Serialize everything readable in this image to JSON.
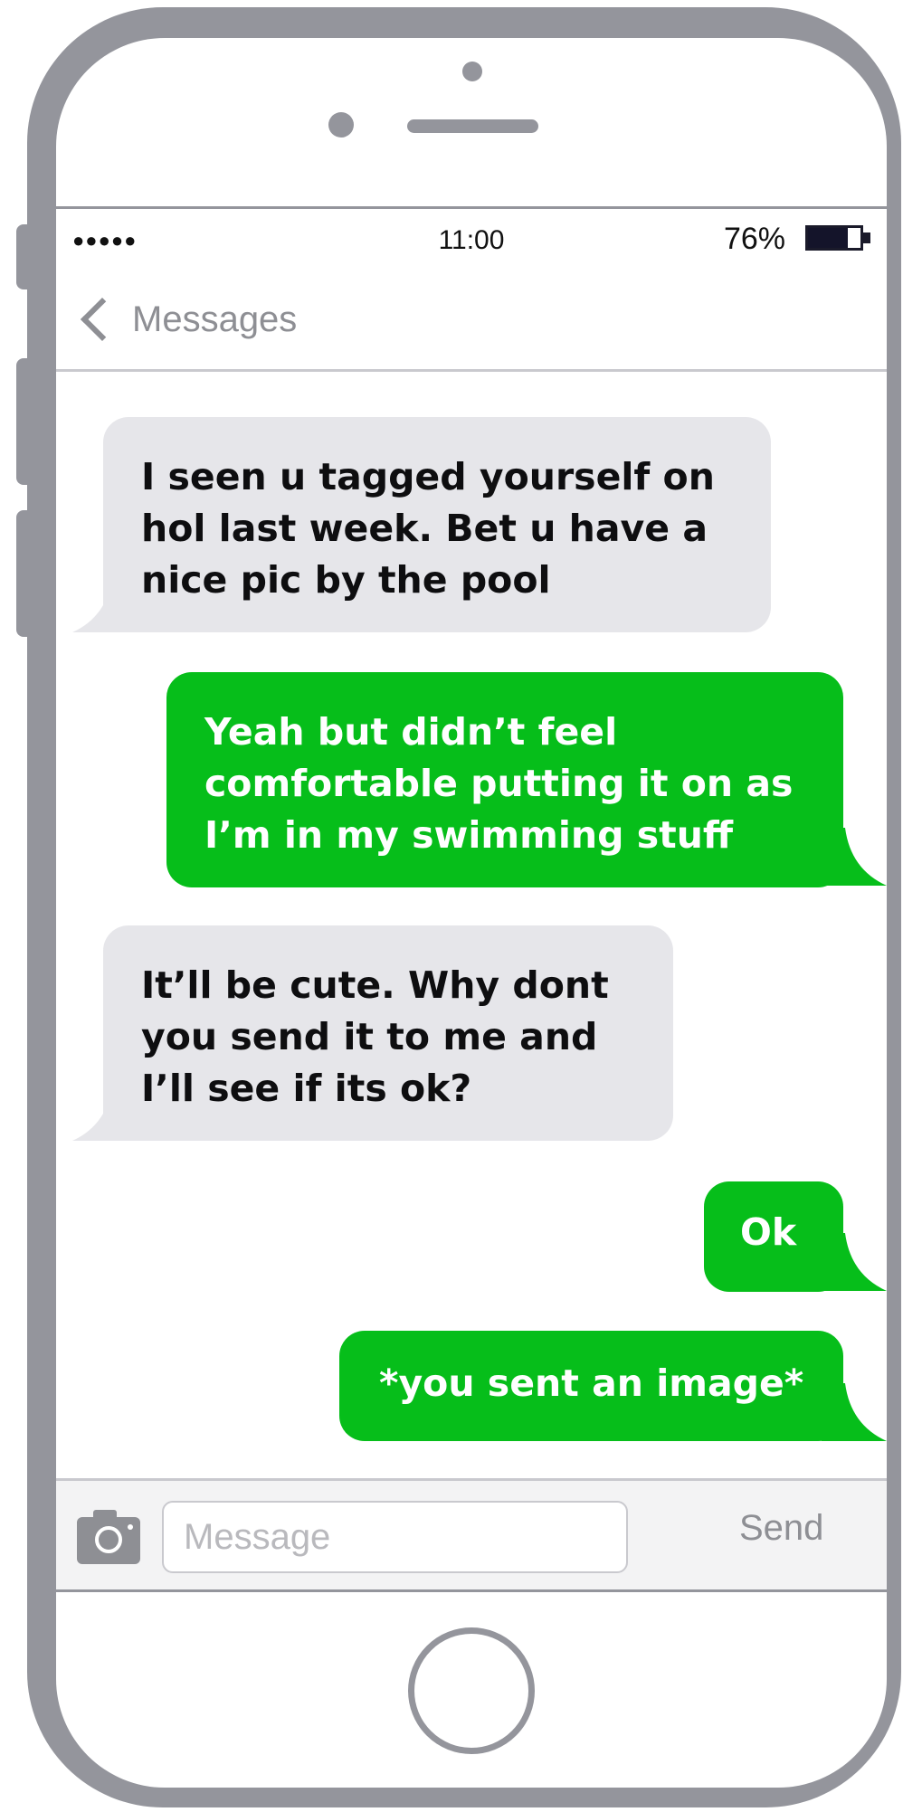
{
  "status": {
    "signal": "●●●●●",
    "time": "11:00",
    "battery_percent": "76%",
    "battery_level": 0.76
  },
  "nav": {
    "back_label": "Messages"
  },
  "messages": [
    {
      "direction": "received",
      "text": "I seen u tagged yourself on hol last week. Bet u have a nice pic by the pool"
    },
    {
      "direction": "sent",
      "text": "Yeah but didn’t feel comfortable putting it on as I’m in my swimming stuff"
    },
    {
      "direction": "received",
      "text": "It’ll be cute. Why dont you send it to me and I’ll see if its ok?"
    },
    {
      "direction": "sent",
      "text": "Ok"
    },
    {
      "direction": "sent",
      "text": "*you sent an image*"
    }
  ],
  "composer": {
    "placeholder": "Message",
    "value": "",
    "send_label": "Send"
  },
  "colors": {
    "sent_bubble": "#06be1a",
    "received_bubble": "#e6e6ea",
    "frame": "#94959c"
  },
  "icons": {
    "back": "chevron-left-icon",
    "camera": "camera-icon"
  }
}
